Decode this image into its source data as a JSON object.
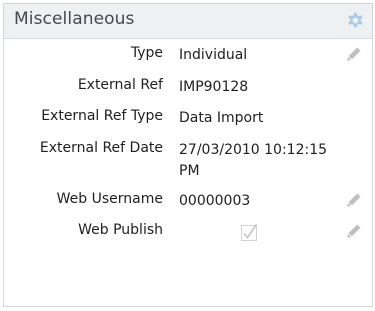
{
  "panel": {
    "title": "Miscellaneous",
    "settings_icon": "gear-icon",
    "edit_icon": "pencil-icon"
  },
  "fields": [
    {
      "label": "Type",
      "value": "Individual",
      "editable": true
    },
    {
      "label": "External Ref",
      "value": "IMP90128",
      "editable": false
    },
    {
      "label": "External Ref Type",
      "value": "Data Import",
      "editable": false
    },
    {
      "label": "External Ref Date",
      "value": "27/03/2010 10:12:15 PM",
      "editable": false
    },
    {
      "label": "Web Username",
      "value": "00000003",
      "editable": true
    },
    {
      "label": "Web Publish",
      "checked": true,
      "editable": true
    }
  ],
  "colors": {
    "header_bg": "#eef0f2",
    "gear": "#a9cbe6",
    "edit_icon": "#bfbfbf",
    "checkmark": "#c4c4c4"
  }
}
